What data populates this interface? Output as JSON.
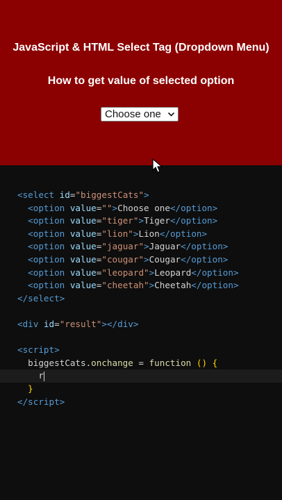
{
  "header": {
    "title": "JavaScript & HTML Select Tag (Dropdown Menu)",
    "subtitle": "How to get value of selected option",
    "select_value": "Choose one"
  },
  "colors": {
    "header_bg": "#8b0000",
    "editor_bg": "#0e0e0e"
  },
  "code": {
    "select_id": "biggestCats",
    "options": [
      {
        "value": "",
        "label": "Choose one"
      },
      {
        "value": "tiger",
        "label": "Tiger"
      },
      {
        "value": "lion",
        "label": "Lion"
      },
      {
        "value": "jaguar",
        "label": "Jaguar"
      },
      {
        "value": "cougar",
        "label": "Cougar"
      },
      {
        "value": "leopard",
        "label": "Leopard"
      },
      {
        "value": "cheetah",
        "label": "Cheetah"
      }
    ],
    "div_id": "result",
    "script_obj": "biggestCats",
    "script_prop": "onchange",
    "script_kw": "function",
    "typed": "r"
  }
}
